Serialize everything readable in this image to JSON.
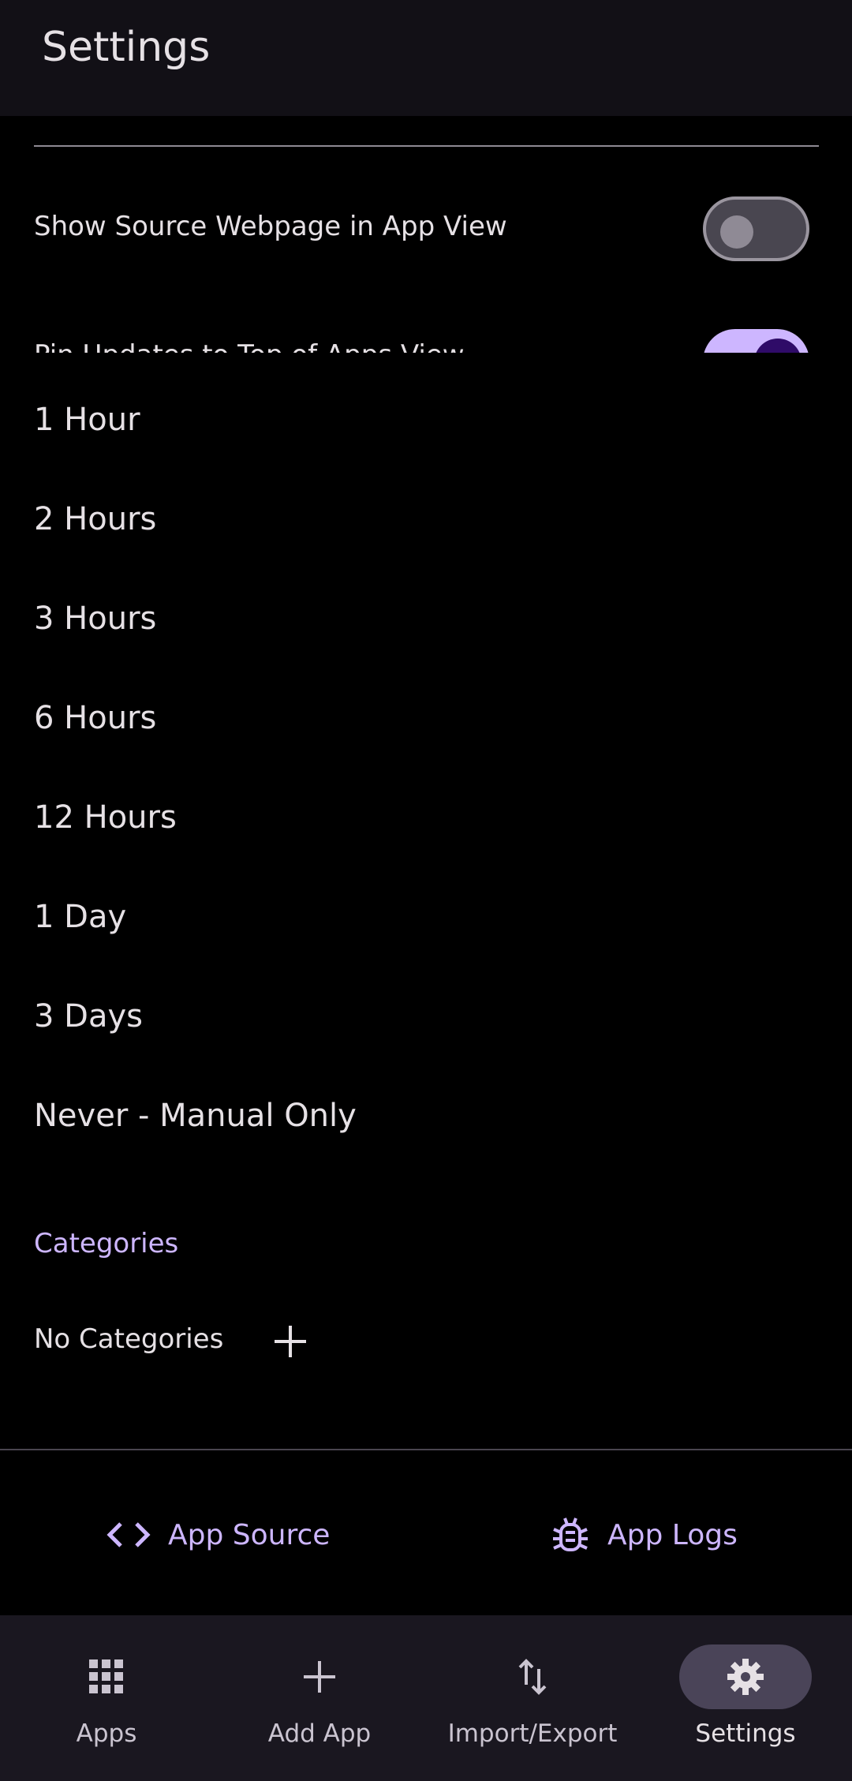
{
  "header": {
    "title": "Settings"
  },
  "background_settings": {
    "show_source_label": "Show Source Webpage in App View",
    "pin_updates_label": "Pin Updates to Top of Apps View"
  },
  "dropdown": {
    "options": [
      "1 Hour",
      "2 Hours",
      "3 Hours",
      "6 Hours",
      "12 Hours",
      "1 Day",
      "3 Days",
      "Never - Manual Only"
    ]
  },
  "categories": {
    "heading": "Categories",
    "empty_text": "No Categories"
  },
  "links": {
    "app_source": "App Source",
    "app_logs": "App Logs"
  },
  "nav": {
    "items": [
      {
        "label": "Apps",
        "icon": "grid-icon"
      },
      {
        "label": "Add App",
        "icon": "plus-icon"
      },
      {
        "label": "Import/Export",
        "icon": "import-export-icon"
      },
      {
        "label": "Settings",
        "icon": "gear-icon",
        "active": true
      }
    ]
  },
  "colors": {
    "accent": "#cdb6ff",
    "surface": "#1a1720",
    "background": "#000000"
  }
}
